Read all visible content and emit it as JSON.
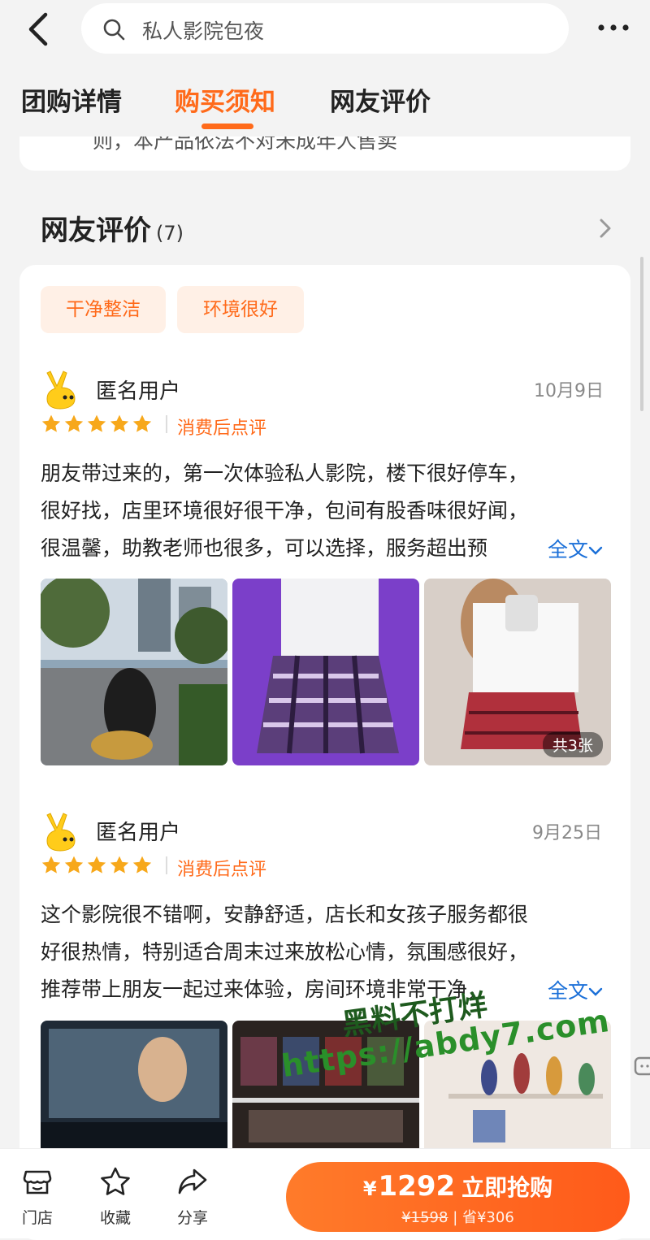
{
  "search": {
    "placeholder": "私人影院包夜"
  },
  "tabs": [
    {
      "label": "团购详情"
    },
    {
      "label": "购买须知"
    },
    {
      "label": "网友评价"
    }
  ],
  "prev_card_text": "则，本产品依法不对未成年人售卖",
  "reviews_section": {
    "title": "网友评价",
    "count": "(7)"
  },
  "chips": [
    {
      "label": "干净整洁"
    },
    {
      "label": "环境很好"
    }
  ],
  "reviews": [
    {
      "user": "匿名用户",
      "date": "10月9日",
      "rating": 5,
      "tag": "消费后点评",
      "lines": [
        "朋友带过来的，第一次体验私人影院，楼下很好停车，",
        "很好找，店里环境很好很干净，包间有股香味很好闻，",
        "很温馨，助教老师也很多，可以选择，服务超出预"
      ],
      "full_text_label": "全文",
      "photo_count": "共3张"
    },
    {
      "user": "匿名用户",
      "date": "9月25日",
      "rating": 5,
      "tag": "消费后点评",
      "lines": [
        "这个影院很不错啊，安静舒适，店长和女孩子服务都很",
        "好很热情，特别适合周末过来放松心情，氛围感很好，",
        "推荐带上朋友一起过来体验，房间环境非常干净，"
      ],
      "full_text_label": "全文"
    }
  ],
  "watermark": {
    "line1": "黑料不打烊",
    "line2": "https://abdy7.com"
  },
  "bottom_nav": [
    {
      "label": "门店",
      "icon": "store-icon"
    },
    {
      "label": "收藏",
      "icon": "star-outline-icon"
    },
    {
      "label": "分享",
      "icon": "share-icon"
    }
  ],
  "buy": {
    "currency": "¥",
    "price": "1292",
    "action": "立即抢购",
    "original": "¥1598",
    "save": "省¥306"
  },
  "colors": {
    "accent": "#ff6a1a",
    "link": "#1a6fd8",
    "star": "#f7a81b"
  }
}
